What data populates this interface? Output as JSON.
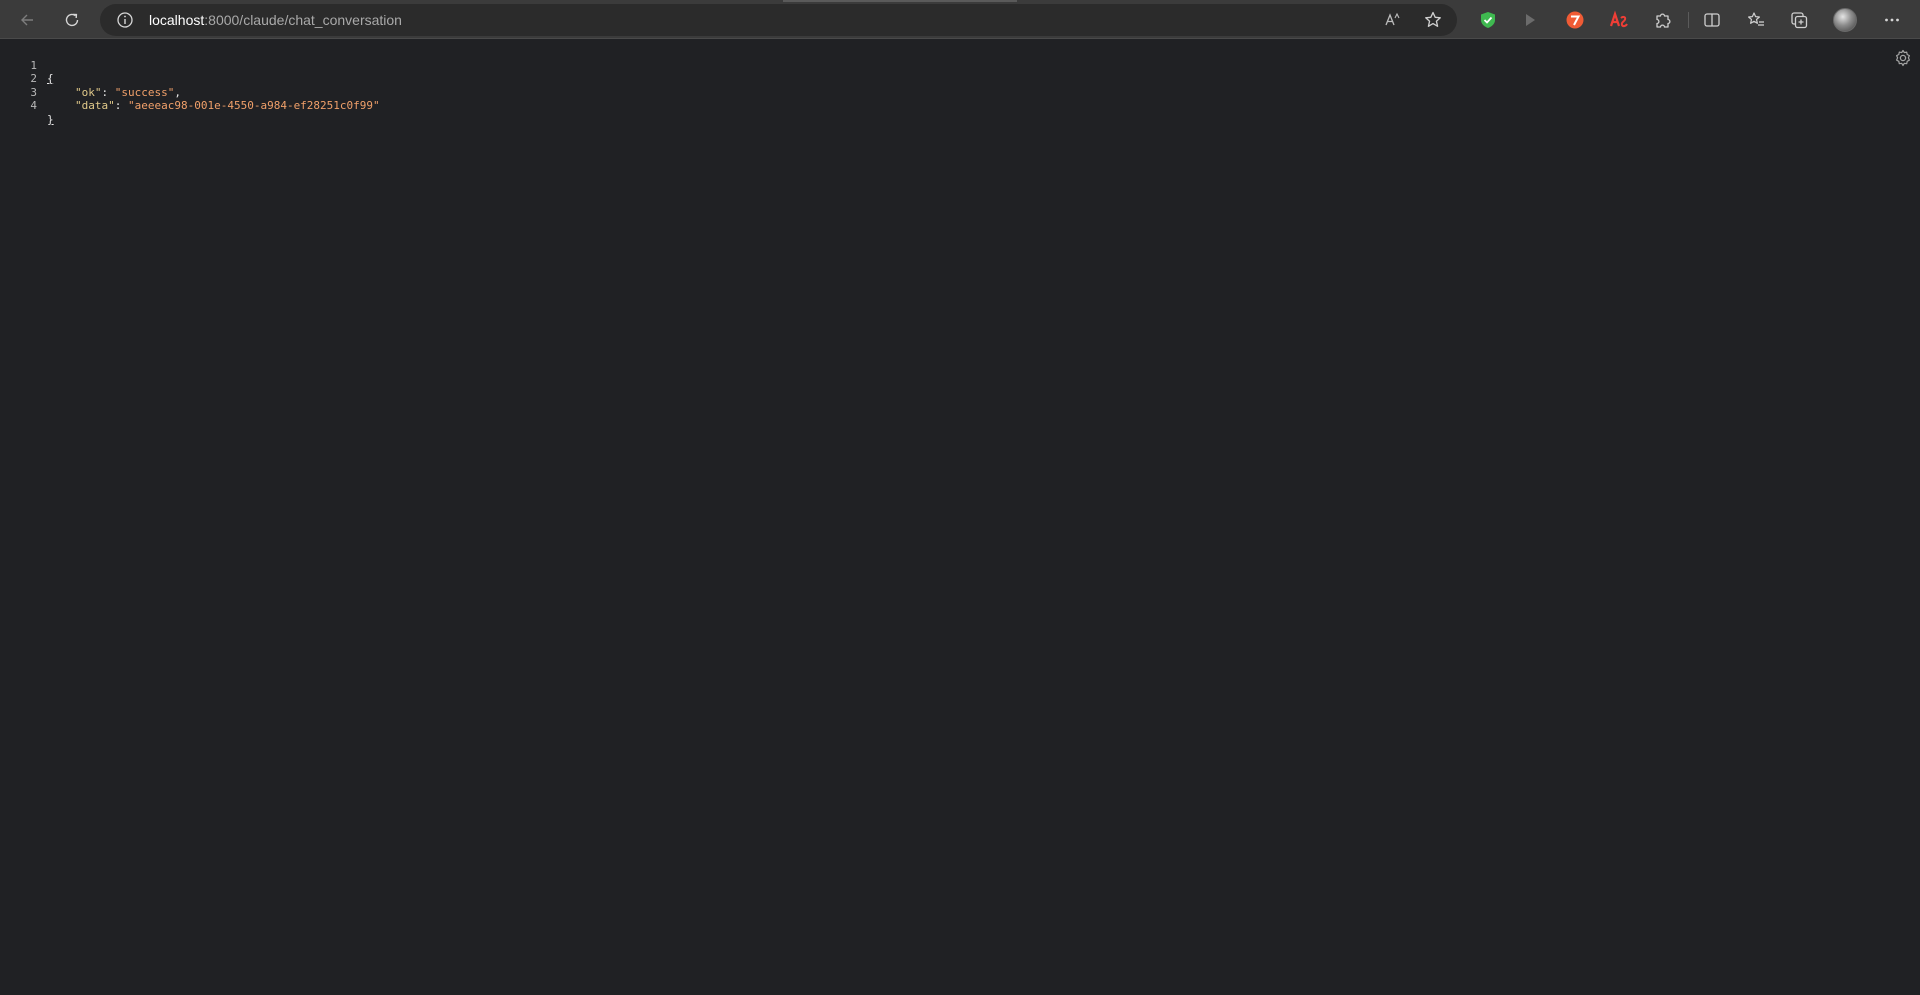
{
  "browser": {
    "url_host": "localhost",
    "url_rest": ":8000/claude/chat_conversation"
  },
  "toolbar_icons": [
    "back-arrow-icon",
    "refresh-icon",
    "site-info-icon",
    "read-aloud-icon",
    "favorite-star-icon",
    "shield-extension-icon",
    "play-extension-icon",
    "red-circle-extension-icon",
    "ab-extension-icon",
    "extensions-puzzle-icon",
    "split-screen-icon",
    "favorites-list-icon",
    "collections-icon",
    "profile-avatar",
    "more-menu-icon"
  ],
  "json_view": {
    "line_numbers": [
      "1",
      "2",
      "3",
      "4"
    ],
    "open_brace": "{",
    "close_brace": "}",
    "entries": [
      {
        "key": "\"ok\"",
        "sep": ": ",
        "value": "\"success\"",
        "trail": ","
      },
      {
        "key": "\"data\"",
        "sep": ": ",
        "value": "\"aeeeac98-001e-4550-a984-ef28251c0f99\"",
        "trail": ""
      }
    ]
  },
  "colors": {
    "background": "#202124",
    "toolbar": "#3b3b3b",
    "json_key": "#e0c98a",
    "json_string": "#f0a06a",
    "shield_green": "#3fb950",
    "ext_red": "#ef4f3a"
  }
}
